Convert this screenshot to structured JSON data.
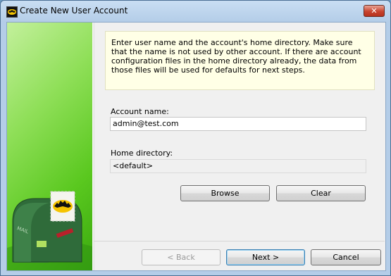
{
  "window": {
    "title": "Create New User Account",
    "close_symbol": "✕"
  },
  "info": {
    "text": "Enter user name and the account's home directory. Make sure that the name is not used by other account. If there are account configuration files in the home directory already, the data from those files will be used for defaults for next steps."
  },
  "form": {
    "account_label": "Account name:",
    "account_value": "admin@test.com",
    "home_label": "Home directory:",
    "home_value": "<default>"
  },
  "buttons": {
    "browse": "Browse",
    "clear": "Clear",
    "back": "< Back",
    "next": "Next >",
    "cancel": "Cancel"
  },
  "side_art": {
    "mailbox_text": "MAIL"
  },
  "colors": {
    "panel_green": "#5ac81f",
    "mailbox_green": "#2f6b3a",
    "info_background": "#ffffe6",
    "close_red": "#c8432e"
  }
}
